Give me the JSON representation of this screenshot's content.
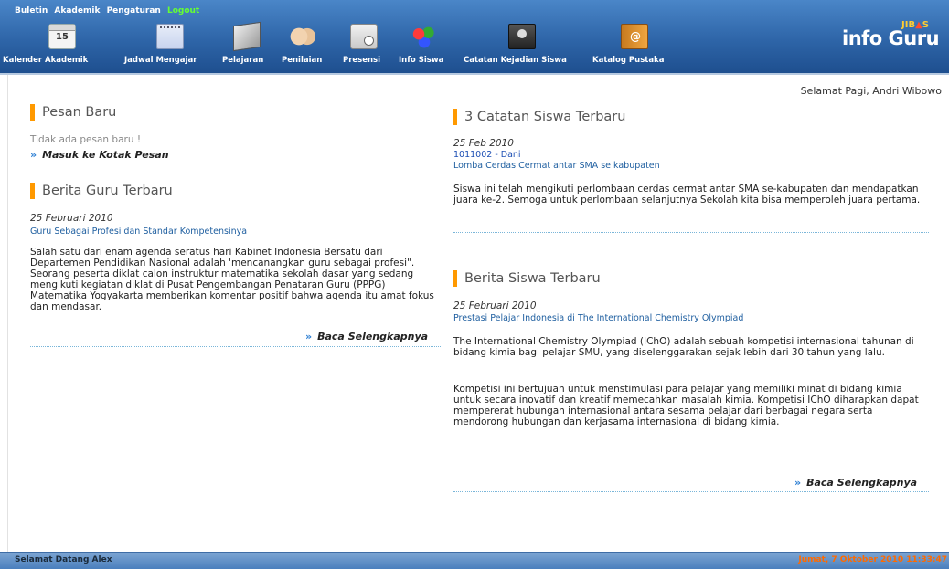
{
  "top_menu": {
    "buletin": "Buletin",
    "akademik": "Akademik",
    "pengaturan": "Pengaturan",
    "logout": "Logout"
  },
  "nav": [
    {
      "label": "Kalender Akademik",
      "icon": "calendar-icon"
    },
    {
      "label": "Jadwal Mengajar",
      "icon": "notepad-icon"
    },
    {
      "label": "Pelajaran",
      "icon": "folder-icon"
    },
    {
      "label": "Penilaian",
      "icon": "handshake-icon"
    },
    {
      "label": "Presensi",
      "icon": "clock-icon"
    },
    {
      "label": "Info Siswa",
      "icon": "people-icon"
    },
    {
      "label": "Catatan Kejadian Siswa",
      "icon": "person-icon"
    },
    {
      "label": "Katalog Pustaka",
      "icon": "book-icon"
    }
  ],
  "calendar_day": "15",
  "logo": {
    "small_prefix": "JIB",
    "small_suffix": "S",
    "main": "info Guru"
  },
  "greeting": "Selamat Pagi, Andri Wibowo",
  "pesan": {
    "title": "Pesan Baru",
    "empty": "Tidak ada pesan baru !",
    "inbox_link": "Masuk ke Kotak Pesan"
  },
  "berita_guru": {
    "title": "Berita Guru Terbaru",
    "date": "25 Februari 2010",
    "headline": "Guru Sebagai Profesi dan Standar Kompetensinya",
    "body": "Salah satu dari enam agenda seratus hari Kabinet Indonesia Bersatu dari Departemen Pendidikan Nasional adalah 'mencanangkan guru sebagai profesi\". Seorang peserta diklat calon instruktur matematika sekolah dasar yang sedang mengikuti kegiatan diklat di Pusat Pengembangan Penataran Guru (PPPG) Matematika Yogyakarta memberikan komentar positif bahwa agenda itu amat fokus dan mendasar.",
    "more": "Baca Selengkapnya"
  },
  "catatan": {
    "title": "3 Catatan Siswa Terbaru",
    "date": "25 Feb 2010",
    "student": "1011002 - Dani",
    "event": "Lomba Cerdas Cermat antar SMA se kabupaten",
    "body": "Siswa ini telah mengikuti perlombaan cerdas cermat antar SMA se-kabupaten dan mendapatkan juara ke-2. Semoga untuk perlombaan selanjutnya Sekolah kita bisa memperoleh juara pertama."
  },
  "berita_siswa": {
    "title": "Berita Siswa Terbaru",
    "date": "25 Februari 2010",
    "headline": "Prestasi Pelajar Indonesia di The International Chemistry Olympiad",
    "body1": "The International Chemistry Olympiad (IChO) adalah sebuah kompetisi internasional tahunan di bidang kimia bagi pelajar SMU, yang diselenggarakan sejak lebih dari 30 tahun yang lalu.",
    "body2": "Kompetisi ini bertujuan untuk menstimulasi para pelajar yang memiliki minat di bidang kimia untuk secara inovatif dan kreatif memecahkan masalah kimia. Kompetisi IChO diharapkan dapat mempererat hubungan internasional antara sesama pelajar dari berbagai negara serta mendorong hubungan dan kerjasama internasional di bidang kimia.",
    "more": "Baca Selengkapnya"
  },
  "footer": {
    "welcome": "Selamat Datang Alex",
    "datetime": "Jumat, 7 Oktober 2010 11:33:47"
  },
  "colors": {
    "header_blue": "#2e65a8",
    "accent_orange": "#ff9900",
    "link_blue": "#1f5fa0",
    "logout_green": "#66ff33",
    "footer_time": "#ff6a00"
  }
}
